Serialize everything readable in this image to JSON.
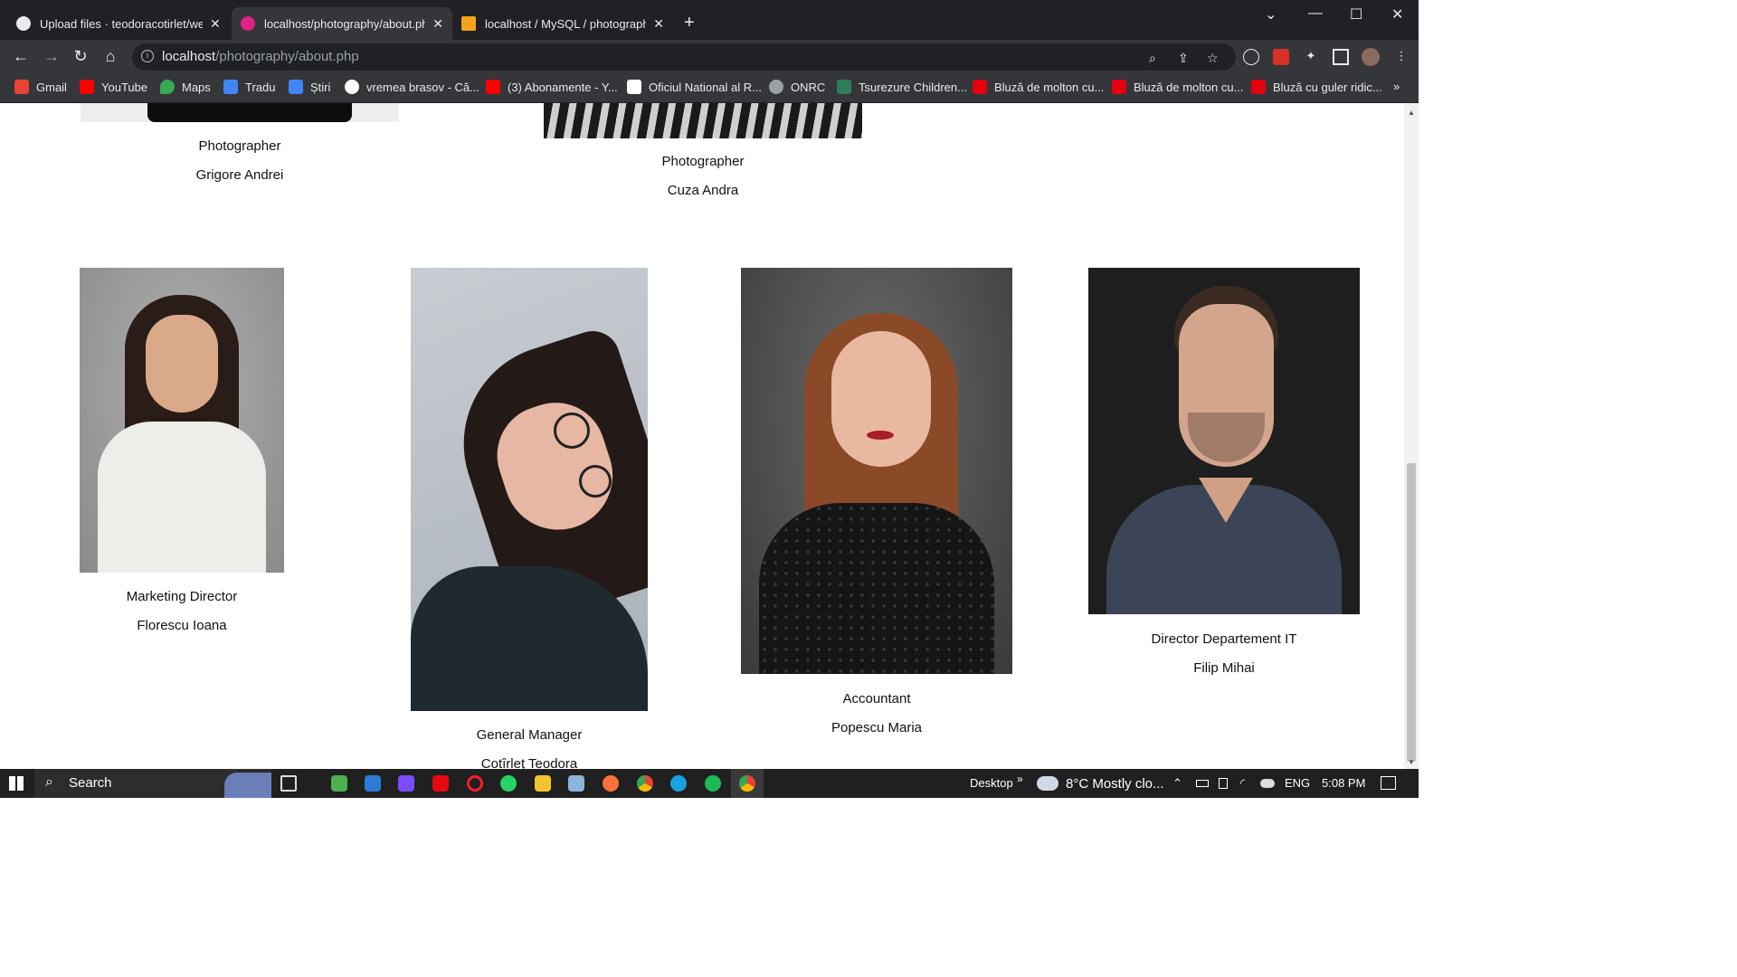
{
  "browser": {
    "tabs": [
      {
        "title": "Upload files · teodoracotirlet/wel",
        "active": false
      },
      {
        "title": "localhost/photography/about.php",
        "active": true
      },
      {
        "title": "localhost / MySQL / photography",
        "active": false
      }
    ],
    "url_host": "localhost",
    "url_path": "/photography/about.php",
    "bookmarks": [
      {
        "label": "Gmail",
        "color": "#ea4335"
      },
      {
        "label": "YouTube",
        "color": "#ff0000"
      },
      {
        "label": "Maps",
        "color": "#34a853"
      },
      {
        "label": "Tradu",
        "color": "#4285f4"
      },
      {
        "label": "Știri",
        "color": "#4285f4"
      },
      {
        "label": "vremea brasov - Că...",
        "color": "#ffffff"
      },
      {
        "label": "(3) Abonamente - Y...",
        "color": "#ff0000"
      },
      {
        "label": "Oficiul National al R...",
        "color": "#ffffff"
      },
      {
        "label": "ONRC",
        "color": "#9aa0a6"
      },
      {
        "label": "Tsurezure Children...",
        "color": "#2e7d5b"
      },
      {
        "label": "Bluză de molton cu...",
        "color": "#e50010"
      },
      {
        "label": "Bluză de molton cu...",
        "color": "#e50010"
      },
      {
        "label": "Bluză cu guler ridic...",
        "color": "#e50010"
      }
    ]
  },
  "team_top": [
    {
      "role": "Photographer",
      "name": "Grigore Andrei"
    },
    {
      "role": "Photographer",
      "name": "Cuza Andra"
    }
  ],
  "team": [
    {
      "role": "Marketing Director",
      "name": "Florescu Ioana",
      "bg": "#9a9a9a",
      "hair": "#2a1d18",
      "cloth": "#ededea"
    },
    {
      "role": "General Manager",
      "name": "Cotîrleț Teodora",
      "bg": "#b9c0c8",
      "hair": "#231a17",
      "cloth": "#1f2a30"
    },
    {
      "role": "Accountant",
      "name": "Popescu Maria",
      "bg": "#4a4a4a",
      "hair": "#8a4a28",
      "cloth": "#151515"
    },
    {
      "role": "Director Departement IT",
      "name": "Filip Mihai",
      "bg": "#222222",
      "hair": "#3a2a22",
      "cloth": "#3c4458"
    }
  ],
  "taskbar": {
    "search_placeholder": "Search",
    "desktop_label": "Desktop",
    "weather": "8°C  Mostly clo...",
    "lang": "ENG",
    "time": "5:08 PM"
  }
}
